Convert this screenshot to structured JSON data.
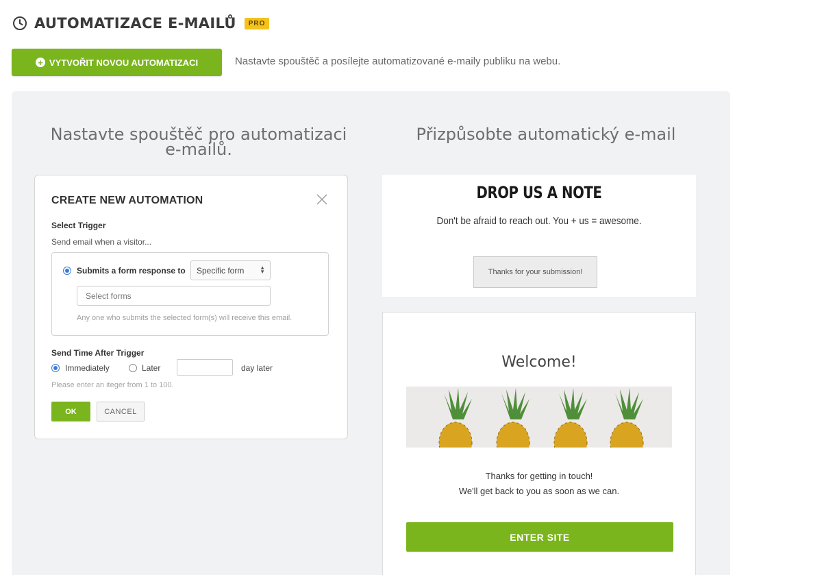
{
  "header": {
    "icon": "clock-icon",
    "title": "AUTOMATIZACE E-MAILŮ",
    "badge": "PRO"
  },
  "create": {
    "button_icon": "plus-circle-icon",
    "button_label": "VYTVOŘIT NOVOU AUTOMATIZACI",
    "description": "Nastavte spouštěč a posílejte automatizované e-maily publiku na webu."
  },
  "panel": {
    "left_heading": "Nastavte spouštěč pro automatizaci e-mailů.",
    "right_heading": "Přizpůsobte automatický e-mail"
  },
  "modal": {
    "title": "CREATE NEW AUTOMATION",
    "select_trigger": "Select Trigger",
    "send_when": "Send email when a visitor...",
    "submits_label": "Submits a form response to",
    "form_select_value": "Specific form",
    "forms_input_placeholder": "Select forms",
    "helper": "Any one who submits the selected form(s) will receive this email.",
    "send_time_label": "Send Time After Trigger",
    "immediately": "Immediately",
    "later": "Later",
    "day_later": "day later",
    "hint": "Please enter an iteger  from 1 to 100.",
    "ok": "OK",
    "cancel": "CANCEL"
  },
  "note_preview": {
    "title": "DROP US A NOTE",
    "subtitle": "Don't be afraid to reach out. You + us = awesome.",
    "button": "Thanks for your submission!"
  },
  "email_preview": {
    "heading": "Welcome!",
    "image": "pineapples-image",
    "line1": "Thanks for getting in touch!",
    "line2": "We'll get back to you as soon as we can.",
    "button": "ENTER SITE"
  },
  "colors": {
    "accent_green": "#7ab51d",
    "pro_badge": "#f4c21b",
    "panel_bg": "#f1f2f4",
    "radio_blue": "#3a7bd5"
  }
}
